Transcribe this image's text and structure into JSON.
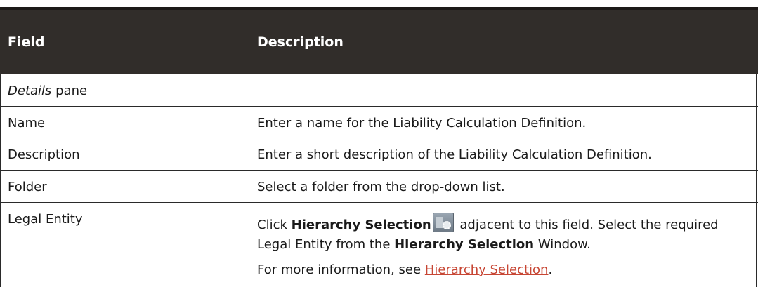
{
  "header": {
    "field": "Field",
    "description": "Description"
  },
  "pane": {
    "title_italic": "Details",
    "title_rest": " pane"
  },
  "rows": [
    {
      "field": "Name",
      "description": "Enter a name for the Liability Calculation Definition."
    },
    {
      "field": "Description",
      "description": "Enter a short description of the Liability Calculation Definition."
    },
    {
      "field": "Folder",
      "description": "Select a folder from the drop-down list."
    }
  ],
  "legal": {
    "field": "Legal Entity",
    "click": "Click ",
    "hierarchy_selection": "Hierarchy Selection",
    "icon": "hierarchy-selection-icon",
    "after_icon": " adjacent to this field. Select the required Legal Entity from the ",
    "window_bold": "Hierarchy Selection",
    "window_rest": " Window.",
    "more_info": "For more information, see ",
    "link": "Hierarchy Selection",
    "period": "."
  },
  "colors": {
    "header_bg": "#312d2a",
    "link": "#c74634"
  }
}
